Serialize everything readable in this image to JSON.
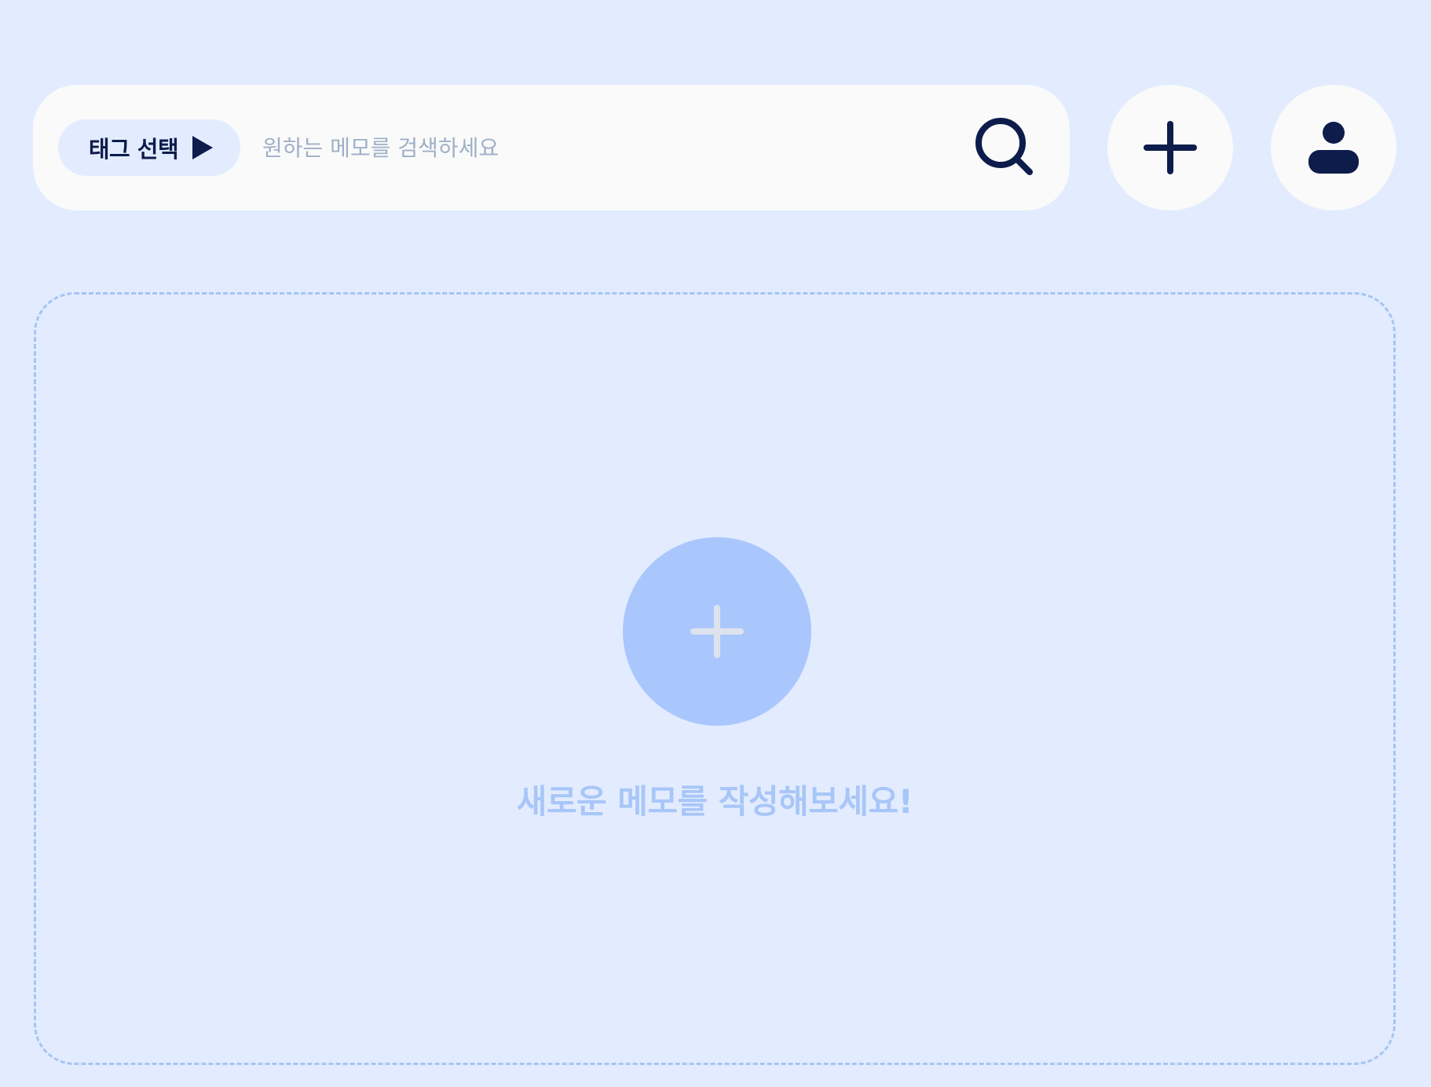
{
  "header": {
    "tag_select_label": "태그 선택",
    "search_placeholder": "원하는 메모를 검색하세요",
    "search_value": "",
    "icons": {
      "tag_arrow": "play-arrow-icon",
      "search": "search-icon",
      "add": "plus-icon",
      "profile": "user-icon"
    }
  },
  "main": {
    "empty_message": "새로운 메모를 작성해보세요!",
    "add_icon": "plus-icon"
  },
  "colors": {
    "background": "#e2ecfe",
    "surface": "#fafafa",
    "primary_dark": "#0d1c4b",
    "accent_light": "#aac7fd",
    "placeholder": "#9fb0c7",
    "dashed_border": "#a6c5f2"
  }
}
